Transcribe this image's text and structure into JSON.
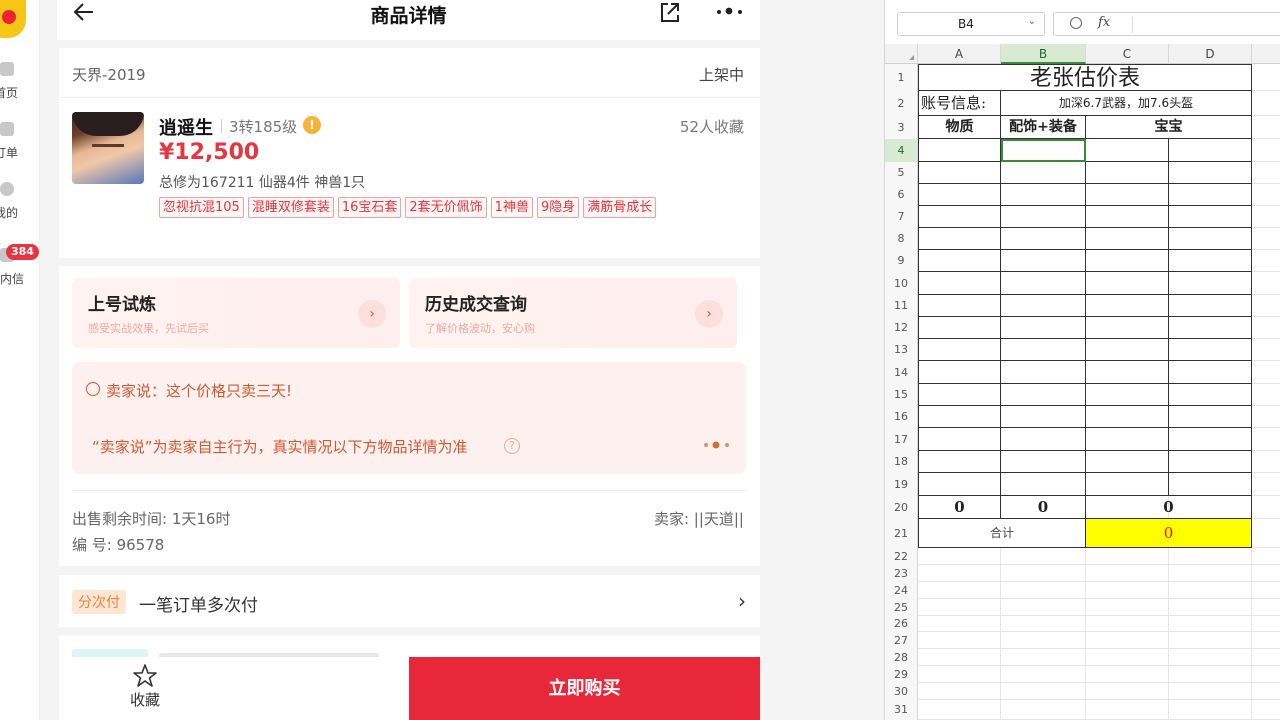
{
  "rail": {
    "items": [
      {
        "label": "首页",
        "icon": "home-icon"
      },
      {
        "label": "订单",
        "icon": "order-icon"
      },
      {
        "label": "我的",
        "icon": "user-icon"
      },
      {
        "label": "站内信",
        "icon": "message-icon",
        "badge": "384"
      }
    ]
  },
  "app": {
    "title": "商品详情",
    "server": "天界-2019",
    "status": "上架中",
    "product": {
      "name": "逍遥生",
      "level": "3转185级",
      "favorites": "52人收藏",
      "price": "¥12,500",
      "subinfo": "总修为167211  仙器4件  神兽1只",
      "tags": [
        "忽视抗混105",
        "混睡双修套装",
        "16宝石套",
        "2套无价佩饰",
        "1神兽",
        "9隐身",
        "满筋骨成长"
      ]
    },
    "features": [
      {
        "title": "上号试炼",
        "subtitle": "感受实战效果，先试后买"
      },
      {
        "title": "历史成交查询",
        "subtitle": "了解价格波动，安心购"
      }
    ],
    "seller_says": "卖家说：这个价格只卖三天!",
    "disclaimer": "“卖家说”为卖家自主行为，真实情况以下方物品详情为准",
    "remaining": "出售剩余时间: 1天16时",
    "serial": "编 号: 96578",
    "seller": "卖家: ||天道||",
    "pay": {
      "badge": "分次付",
      "text": "一笔订单多次付"
    },
    "bottom": {
      "fav_label": "收藏",
      "buy_label": "立即购买"
    }
  },
  "sheet": {
    "name_box": "B4",
    "fx": "fx",
    "columns": [
      "A",
      "B",
      "C",
      "D"
    ],
    "rows": [
      "1",
      "2",
      "3",
      "4",
      "5",
      "6",
      "7",
      "8",
      "9",
      "10",
      "11",
      "12",
      "13",
      "14",
      "15",
      "16",
      "17",
      "18",
      "19",
      "20",
      "21",
      "22",
      "23",
      "24",
      "25",
      "26",
      "27",
      "28",
      "29",
      "30",
      "31"
    ],
    "title": "老张估价表",
    "account_label": "账号信息:",
    "account_value": "加深6.7武器，加7.6头盔",
    "headers": [
      "物质",
      "配饰+装备",
      "宝宝"
    ],
    "totals": [
      "0",
      "0",
      "0"
    ],
    "sum_label": "合计",
    "sum_value": "0",
    "colors": {
      "selected": "#3a8a3a",
      "sum_fill": "#ffff00",
      "sum_text": "#ff0000"
    }
  }
}
